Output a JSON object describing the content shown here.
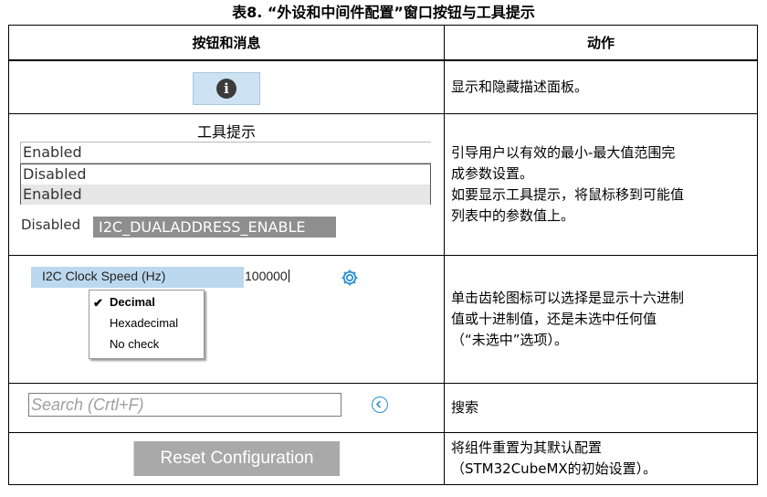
{
  "title": "表8. “外设和中间件配置”窗口按钮与工具提示",
  "headers": {
    "col1": "按钮和消息",
    "col2": "动作"
  },
  "rows": [
    {
      "action_lines": [
        "显示和隐藏描述面板。"
      ]
    },
    {
      "action_lines": [
        "引导用户以有效的最小-最大值范围完",
        "成参数设置。",
        "如要显示工具提示，将鼠标移到可能值",
        "列表中的参数值上。"
      ]
    },
    {
      "action_lines": [
        "单击齿轮图标可以选择是显示十六进制",
        "值或十进制值，还是未选中任何值",
        "（“未选中”选项）。"
      ]
    },
    {
      "action_lines": [
        "搜索"
      ]
    },
    {
      "action_lines": [
        "将组件重置为其默认配置",
        "（STM32CubeMX的初始设置）。"
      ]
    }
  ],
  "info_button": {
    "icon": "info-icon"
  },
  "tooltip_demo": {
    "heading": "工具提示",
    "field_value": "Enabled",
    "options": [
      "Disabled",
      "Enabled"
    ],
    "bottom_label": "Disabled",
    "tooltip_text": "I2C_DUALADDRESS_ENABLE"
  },
  "clock_speed": {
    "label": "I2C Clock Speed (Hz)",
    "value": "100000",
    "menu_items": [
      "Decimal",
      "Hexadecimal",
      "No check"
    ],
    "checked_item": "Decimal"
  },
  "search": {
    "placeholder": "Search (Crtl+F)"
  },
  "reset": {
    "label": "Reset Configuration"
  },
  "colors": {
    "accent_blue": "#2b8fd0",
    "label_bg": "#bcd8ee",
    "button_gray": "#a9a9a9"
  }
}
